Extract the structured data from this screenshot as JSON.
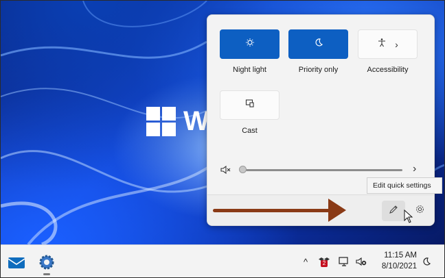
{
  "desktop": {
    "logo_text": "W"
  },
  "quick_settings": {
    "tiles": [
      {
        "label": "Night light",
        "icon": "night-light-icon",
        "active": true
      },
      {
        "label": "Priority only",
        "icon": "moon-icon",
        "active": true
      },
      {
        "label": "Accessibility",
        "icon": "accessibility-icon",
        "active": false,
        "expand": "›"
      },
      {
        "label": "Cast",
        "icon": "cast-icon",
        "active": false
      }
    ],
    "volume": {
      "muted": true,
      "level": 0,
      "expand": "›"
    },
    "footer": {
      "edit_icon": "pencil-icon",
      "settings_icon": "gear-icon"
    },
    "tooltip": "Edit quick settings"
  },
  "taskbar": {
    "apps": [
      {
        "name": "mail-icon"
      },
      {
        "name": "settings-gear-icon"
      }
    ],
    "tray": {
      "chevron": "^",
      "badge_count": "2",
      "date": "8/10/2021",
      "time": "11:15 AM"
    }
  },
  "colors": {
    "accent": "#0d5fc2",
    "arrow": "#8a3a16",
    "panel_bg": "#f3f3f3"
  }
}
